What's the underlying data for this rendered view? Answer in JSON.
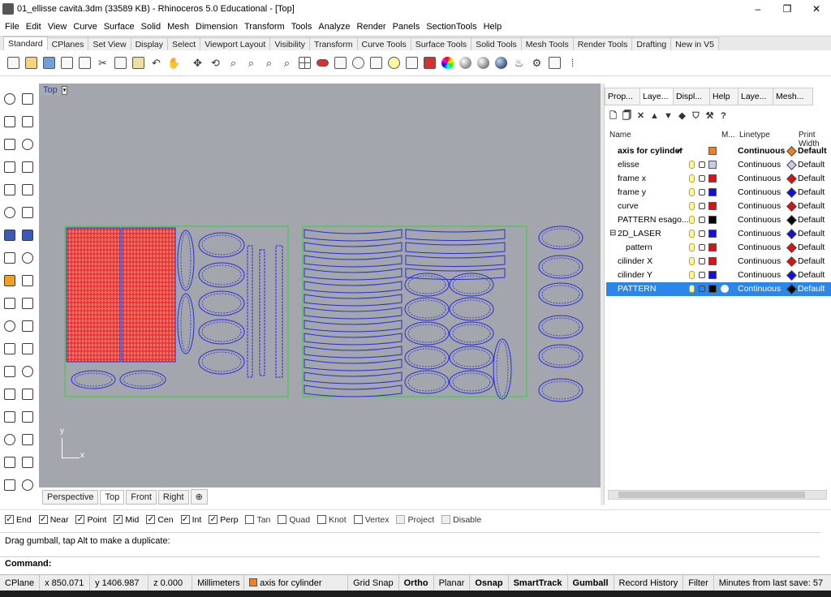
{
  "window": {
    "title": "01_ellisse cavità.3dm (33589 KB) - Rhinoceros 5.0 Educational - [Top]",
    "minimize": "–",
    "maximize": "❐",
    "close": "✕"
  },
  "menu": [
    "File",
    "Edit",
    "View",
    "Curve",
    "Surface",
    "Solid",
    "Mesh",
    "Dimension",
    "Transform",
    "Tools",
    "Analyze",
    "Render",
    "Panels",
    "SectionTools",
    "Help"
  ],
  "toolbar_tabs": [
    "Standard",
    "CPlanes",
    "Set View",
    "Display",
    "Select",
    "Viewport Layout",
    "Visibility",
    "Transform",
    "Curve Tools",
    "Surface Tools",
    "Solid Tools",
    "Mesh Tools",
    "Render Tools",
    "Drafting",
    "New in V5"
  ],
  "active_toolbar_tab": "Standard",
  "viewport": {
    "label": "Top",
    "dropdown_arrow": "▾",
    "axis_y": "y",
    "axis_x": "x",
    "colors": {
      "background": "#a3a7ad",
      "curve": "#2a2ad6",
      "hatch": "#e8352e",
      "border": "#2ed52e"
    }
  },
  "viewport_tabs": [
    "Perspective",
    "Top",
    "Front",
    "Right",
    "⊕"
  ],
  "active_viewport_tab": "Top",
  "osnaps": [
    {
      "label": "End",
      "checked": true
    },
    {
      "label": "Near",
      "checked": true
    },
    {
      "label": "Point",
      "checked": true
    },
    {
      "label": "Mid",
      "checked": true
    },
    {
      "label": "Cen",
      "checked": true
    },
    {
      "label": "Int",
      "checked": true
    },
    {
      "label": "Perp",
      "checked": true
    },
    {
      "label": "Tan",
      "checked": false
    },
    {
      "label": "Quad",
      "checked": false
    },
    {
      "label": "Knot",
      "checked": false
    },
    {
      "label": "Vertex",
      "checked": false
    },
    {
      "label": "Project",
      "checked": false
    },
    {
      "label": "Disable",
      "checked": false
    }
  ],
  "command_history": "Drag gumball, tap Alt to make a duplicate:",
  "command_prompt": "Command:",
  "status": {
    "cplane": "CPlane",
    "x": "x 850.071",
    "y": "y 1406.987",
    "z": "z 0.000",
    "units": "Millimeters",
    "current_layer": "axis for cylinder",
    "layer_color": "#f08020",
    "grid_snap": "Grid Snap",
    "ortho": "Ortho",
    "planar": "Planar",
    "osnap": "Osnap",
    "smarttrack": "SmartTrack",
    "gumball": "Gumball",
    "record_history": "Record History",
    "filter": "Filter",
    "last_save": "Minutes from last save: 57"
  },
  "panel": {
    "tabs": [
      "Prop...",
      "Laye...",
      "Displ...",
      "Help",
      "Laye...",
      "Mesh..."
    ],
    "active_tab": "Laye...",
    "tab_icons": [
      "properties-icon",
      "layers-icon",
      "display-icon",
      "help-icon",
      "layers-icon",
      "mesh-icon"
    ],
    "headers": {
      "name": "Name",
      "material": "M...",
      "linetype": "Linetype",
      "print_width": "Print Width"
    },
    "layers": [
      {
        "name": "axis for cylinder",
        "current": true,
        "check": "✓",
        "color": "#f08020",
        "linetype": "Continuous",
        "print": "Default",
        "print_color": "#f08020",
        "indent": 0,
        "selected": false
      },
      {
        "name": "elisse",
        "current": false,
        "check": "",
        "color": "#c9c9f0",
        "linetype": "Continuous",
        "print": "Default",
        "print_color": "#c9c9f0",
        "indent": 0,
        "selected": false
      },
      {
        "name": "frame x",
        "current": false,
        "check": "",
        "color": "#e01010",
        "linetype": "Continuous",
        "print": "Default",
        "print_color": "#e01010",
        "indent": 0,
        "selected": false
      },
      {
        "name": "frame y",
        "current": false,
        "check": "",
        "color": "#1010e0",
        "linetype": "Continuous",
        "print": "Default",
        "print_color": "#1010e0",
        "indent": 0,
        "selected": false
      },
      {
        "name": "curve",
        "current": false,
        "check": "",
        "color": "#e01010",
        "linetype": "Continuous",
        "print": "Default",
        "print_color": "#e01010",
        "indent": 0,
        "selected": false
      },
      {
        "name": "PATTERN esago...",
        "current": false,
        "check": "",
        "color": "#000000",
        "linetype": "Continuous",
        "print": "Default",
        "print_color": "#000000",
        "indent": 0,
        "selected": false
      },
      {
        "name": "2D_LASER",
        "current": false,
        "check": "",
        "color": "#1010e0",
        "linetype": "Continuous",
        "print": "Default",
        "print_color": "#1010e0",
        "indent": 0,
        "selected": false,
        "expander": "⊟"
      },
      {
        "name": "pattern",
        "current": false,
        "check": "",
        "color": "#e01010",
        "linetype": "Continuous",
        "print": "Default",
        "print_color": "#e01010",
        "indent": 1,
        "selected": false
      },
      {
        "name": "cilinder X",
        "current": false,
        "check": "",
        "color": "#e01010",
        "linetype": "Continuous",
        "print": "Default",
        "print_color": "#e01010",
        "indent": 0,
        "selected": false
      },
      {
        "name": "cilinder Y",
        "current": false,
        "check": "",
        "color": "#1010e0",
        "linetype": "Continuous",
        "print": "Default",
        "print_color": "#1010e0",
        "indent": 0,
        "selected": false
      },
      {
        "name": "PATTERN",
        "current": false,
        "check": "",
        "color": "#000000",
        "linetype": "Continuous",
        "print": "Default",
        "print_color": "#000000",
        "indent": 0,
        "selected": true
      }
    ]
  }
}
